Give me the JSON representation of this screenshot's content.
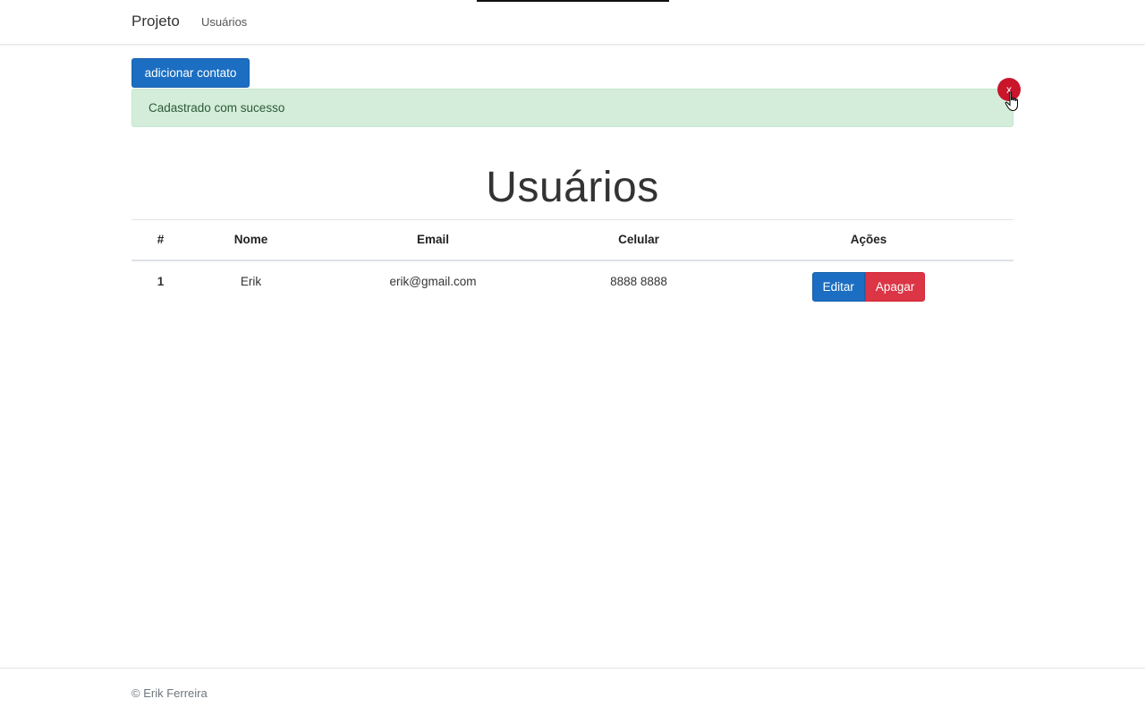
{
  "navbar": {
    "brand": "Projeto",
    "links": [
      "Usuários"
    ]
  },
  "actions": {
    "add_contact_label": "adicionar contato"
  },
  "alert": {
    "message": "Cadastrado com sucesso",
    "close_label": "x"
  },
  "page_title": "Usuários",
  "table": {
    "headers": [
      "#",
      "Nome",
      "Email",
      "Celular",
      "Ações"
    ],
    "rows": [
      {
        "id": "1",
        "nome": "Erik",
        "email": "erik@gmail.com",
        "celular": "8888 8888",
        "edit_label": "Editar",
        "delete_label": "Apagar"
      }
    ]
  },
  "footer": {
    "text": "© Erik Ferreira"
  },
  "colors": {
    "primary": "#1b6ec2",
    "danger": "#dc3545",
    "success_bg": "#d4edda",
    "close_badge": "#c9162b"
  },
  "icons": {
    "cursor": "hand-pointer-icon"
  }
}
